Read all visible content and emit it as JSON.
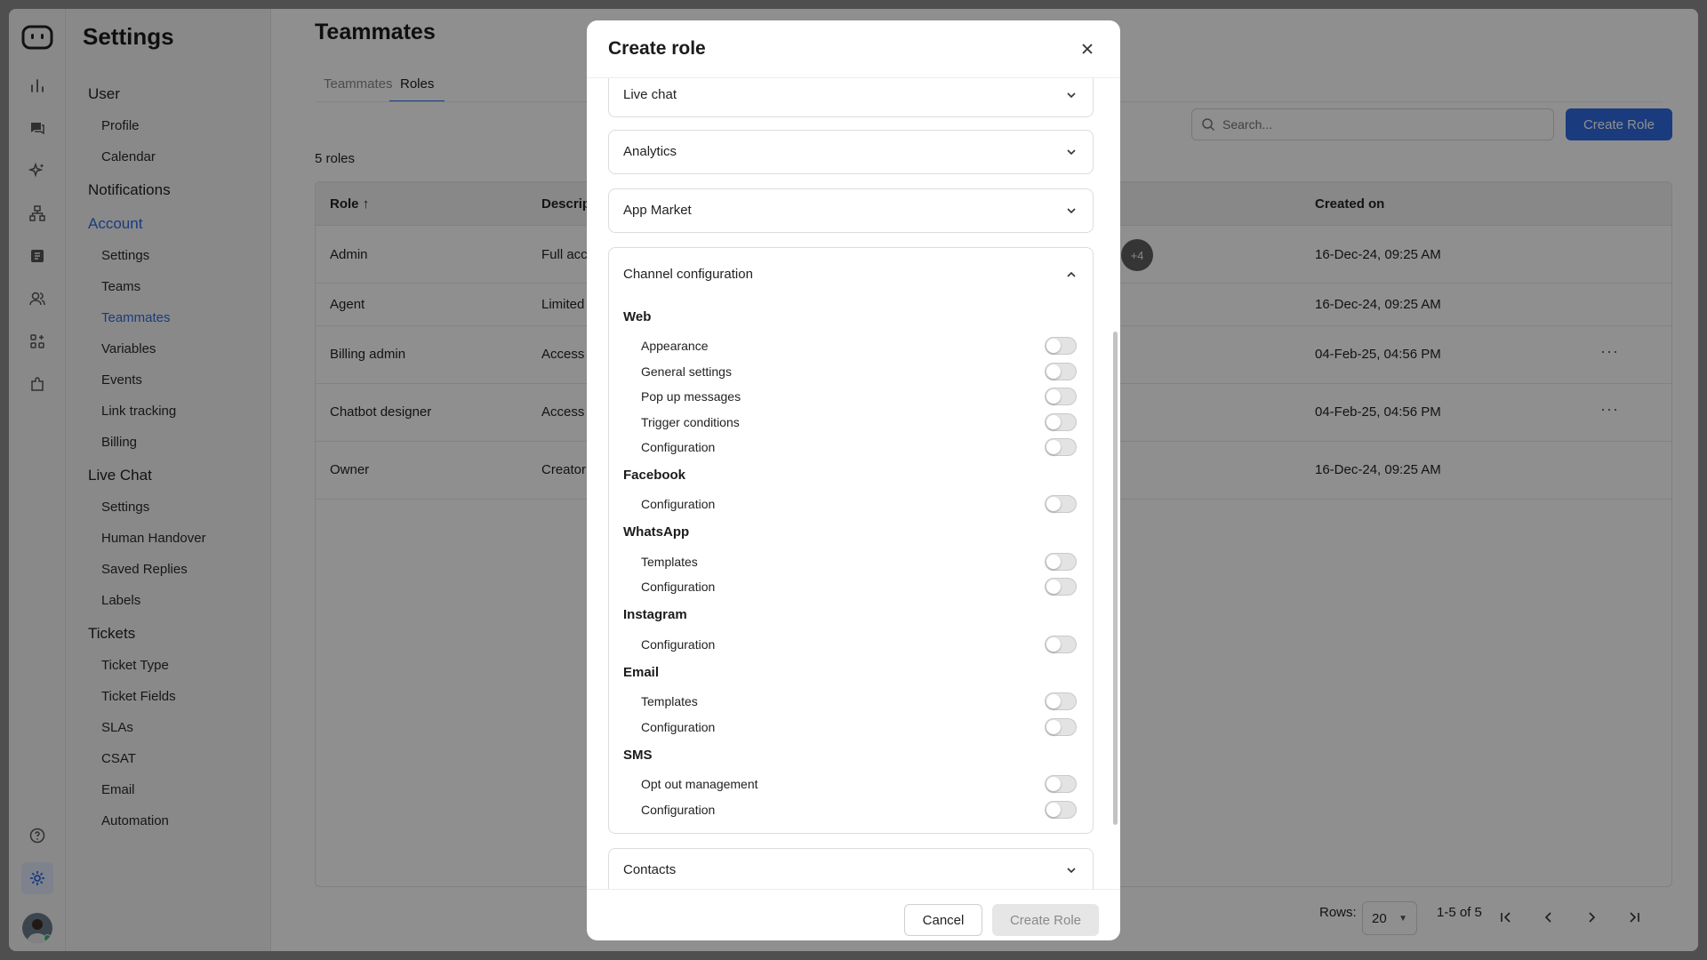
{
  "sidebar": {
    "title": "Settings",
    "groups": {
      "user": "User",
      "notifications": "Notifications",
      "account": "Account",
      "live_chat": "Live Chat",
      "tickets": "Tickets"
    },
    "items": {
      "profile": "Profile",
      "calendar": "Calendar",
      "settings": "Settings",
      "teams": "Teams",
      "teammates": "Teammates",
      "variables": "Variables",
      "events": "Events",
      "link_tracking": "Link tracking",
      "billing": "Billing",
      "lc_settings": "Settings",
      "human_handover": "Human Handover",
      "saved_replies": "Saved Replies",
      "labels": "Labels",
      "ticket_type": "Ticket Type",
      "ticket_fields": "Ticket Fields",
      "slas": "SLAs",
      "csat": "CSAT",
      "email": "Email",
      "automation": "Automation"
    }
  },
  "main": {
    "title": "Teammates",
    "tabs": [
      "Teammates",
      "Roles"
    ],
    "count": "5 roles",
    "search_placeholder": "Search...",
    "create_button": "Create Role",
    "columns": {
      "role": "Role",
      "description": "Descrip",
      "created": "Created on"
    },
    "rows": [
      {
        "role": "Admin",
        "description": "Full acc",
        "created": "16-Dec-24, 09:25 AM"
      },
      {
        "role": "Agent",
        "description": "Limited",
        "created": "16-Dec-24, 09:25 AM"
      },
      {
        "role": "Billing admin",
        "description": "Access",
        "created": "04-Feb-25, 04:56 PM"
      },
      {
        "role": "Chatbot designer",
        "description": "Access",
        "created": "04-Feb-25, 04:56 PM"
      },
      {
        "role": "Owner",
        "description": "Creator",
        "created": "16-Dec-24, 09:25 AM"
      }
    ],
    "avatar_more": "+4",
    "more_label": "···",
    "pagination": {
      "rows_label": "Rows:",
      "rows_value": "20",
      "range": "1-5 of 5"
    }
  },
  "modal": {
    "title": "Create role",
    "sections": {
      "live_chat": "Live chat",
      "analytics": "Analytics",
      "app_market": "App Market",
      "channel_configuration": "Channel configuration",
      "contacts": "Contacts"
    },
    "channels": {
      "web": {
        "label": "Web",
        "permissions": [
          "Appearance",
          "General settings",
          "Pop up messages",
          "Trigger conditions",
          "Configuration"
        ]
      },
      "facebook": {
        "label": "Facebook",
        "permissions": [
          "Configuration"
        ]
      },
      "whatsapp": {
        "label": "WhatsApp",
        "permissions": [
          "Templates",
          "Configuration"
        ]
      },
      "instagram": {
        "label": "Instagram",
        "permissions": [
          "Configuration"
        ]
      },
      "email": {
        "label": "Email",
        "permissions": [
          "Templates",
          "Configuration"
        ]
      },
      "sms": {
        "label": "SMS",
        "permissions": [
          "Opt out management",
          "Configuration"
        ]
      }
    },
    "cancel": "Cancel",
    "create": "Create Role"
  }
}
